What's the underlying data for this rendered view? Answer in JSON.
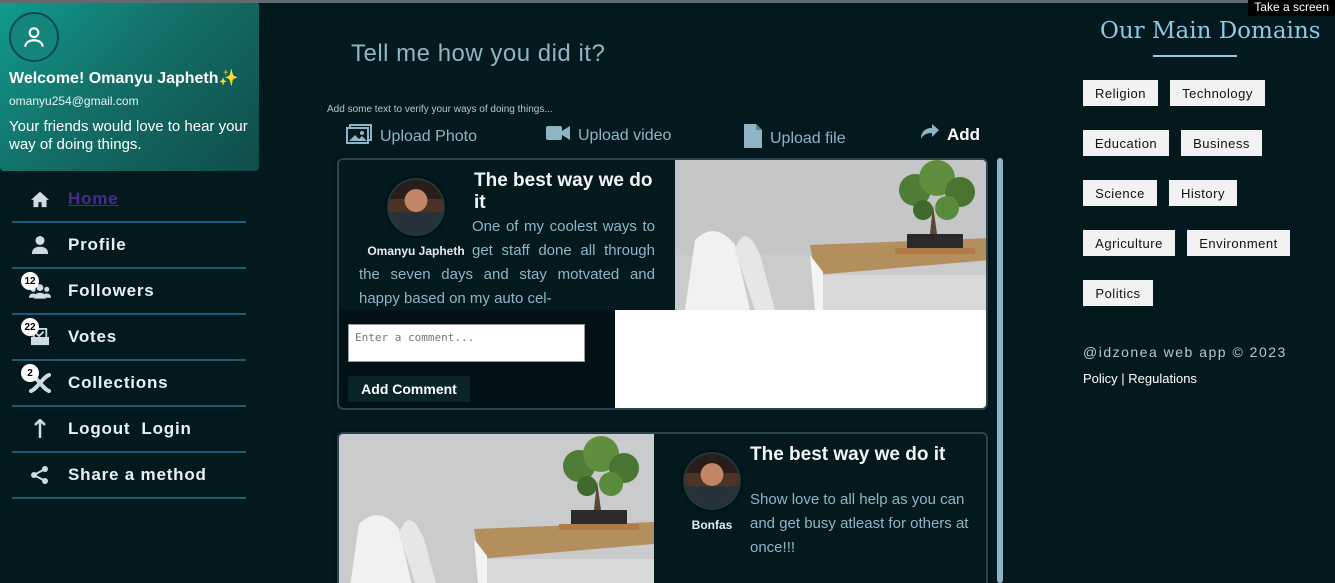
{
  "screen_tooltip": "Take a screen",
  "profile": {
    "welcome": "Welcome! Omanyu Japheth",
    "sparkle": "✨",
    "email": "omanyu254@gmail.com",
    "invite": "Your friends would love to hear your way of doing things."
  },
  "menu": {
    "home": "Home",
    "profile": "Profile",
    "followers": "Followers",
    "followers_count": "12",
    "votes": "Votes",
    "votes_count": "22",
    "collections": "Collections",
    "collections_count": "2",
    "logout_login": "Logout  Login",
    "share": "Share a method"
  },
  "composer": {
    "prompt": "Tell me how you did it?",
    "hint": "Add some text to verify your ways of doing things...",
    "upload_photo": "Upload Photo",
    "upload_video": "Upload video",
    "upload_file": "Upload file",
    "add": "Add"
  },
  "posts": [
    {
      "author": "Omanyu Japheth",
      "title": "The best way we do it",
      "body": "One of my coolest ways to get staff done all through the seven days and stay motvated and happy based on my auto cel-",
      "comment_placeholder": "Enter a comment...",
      "comment_button": "Add Comment"
    },
    {
      "author": "Bonfas",
      "title": "The best way we do it",
      "body": "Show love to all help as you can and get busy atleast for others at once!!!"
    }
  ],
  "domains": {
    "title": "Our Main Domains",
    "tags": [
      "Religion",
      "Technology",
      "Education",
      "Business",
      "Science",
      "History",
      "Agriculture",
      "Environment",
      "Politics"
    ]
  },
  "footer": {
    "brand": "@idzonea web app © 2023",
    "links": "Policy | Regulations"
  },
  "colors": {
    "background": "#03191e",
    "accent_teal": "#0f9b8e",
    "muted_text": "#8fb5c4",
    "active_link": "#4a2a92"
  }
}
